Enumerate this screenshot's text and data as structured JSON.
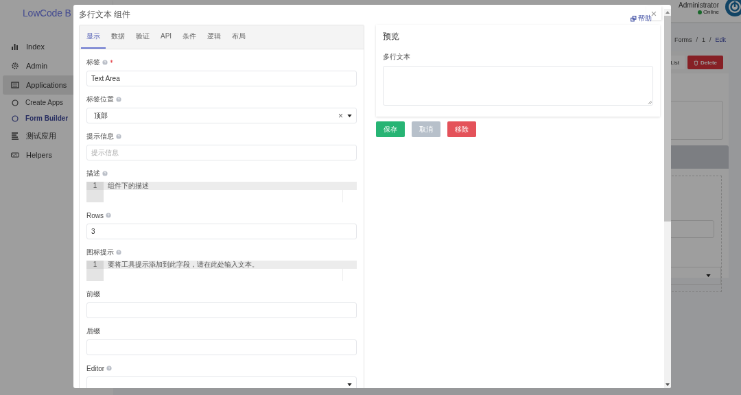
{
  "app": {
    "brand": "LowCode B",
    "user": {
      "name": "Administrator",
      "status": "Online"
    },
    "sidebar": [
      {
        "label": "Index",
        "expanded": false
      },
      {
        "label": "Admin",
        "expanded": false
      },
      {
        "label": "Applications",
        "expanded": true,
        "children": [
          {
            "label": "Create Apps",
            "selected": false
          },
          {
            "label": "Form Builder",
            "selected": true
          }
        ]
      },
      {
        "label": "测试应用",
        "expanded": false
      },
      {
        "label": "Helpers",
        "expanded": false
      }
    ],
    "breadcrumb": {
      "items": [
        "Forms",
        "1",
        "Edit"
      ],
      "separator": "/"
    },
    "actions": [
      {
        "label": "List",
        "kind": "plain"
      },
      {
        "label": "Delete",
        "kind": "danger"
      }
    ]
  },
  "dialog": {
    "title": "多行文本 组件",
    "help": "帮助",
    "close": "×",
    "tabs": [
      {
        "label": "显示",
        "selected": true
      },
      {
        "label": "数据",
        "selected": false
      },
      {
        "label": "验证",
        "selected": false
      },
      {
        "label": "API",
        "selected": false
      },
      {
        "label": "条件",
        "selected": false
      },
      {
        "label": "逻辑",
        "selected": false
      },
      {
        "label": "布局",
        "selected": false
      }
    ],
    "fields": [
      {
        "kind": "input",
        "label": "标签",
        "help": true,
        "required": true,
        "value": "Text Area"
      },
      {
        "kind": "select",
        "label": "标签位置",
        "help": true,
        "required": false,
        "value": "顶部",
        "clear": "×"
      },
      {
        "kind": "input",
        "label": "提示信息",
        "help": true,
        "required": false,
        "placeholder": "提示信息"
      },
      {
        "kind": "code",
        "label": "描述",
        "help": true,
        "required": false,
        "line": "1",
        "value": "组件下的描述"
      },
      {
        "kind": "input",
        "label": "Rows",
        "help": true,
        "required": false,
        "value": "3"
      },
      {
        "kind": "code",
        "label": "图标提示",
        "help": true,
        "required": false,
        "line": "1",
        "value": "要将工具提示添加到此字段，请在此处输入文本。"
      },
      {
        "kind": "input",
        "label": "前缀",
        "help": false,
        "required": false
      },
      {
        "kind": "input",
        "label": "后缀",
        "help": false,
        "required": false
      },
      {
        "kind": "select",
        "label": "Editor",
        "help": true,
        "required": false
      }
    ],
    "preview": {
      "title": "预览",
      "field_label": "多行文本"
    },
    "buttons": [
      {
        "label": "保存",
        "kind": "primary"
      },
      {
        "label": "取消",
        "kind": "secondary"
      },
      {
        "label": "移除",
        "kind": "danger"
      }
    ]
  }
}
